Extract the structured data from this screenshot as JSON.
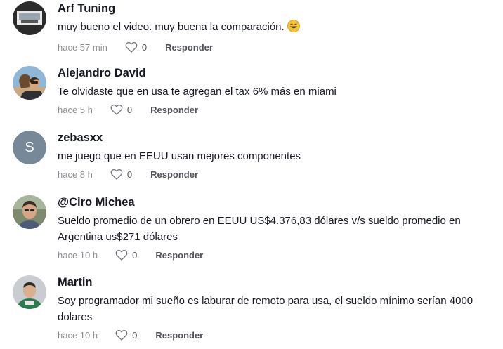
{
  "comments": [
    {
      "username": "Arf Tuning",
      "text": "muy bueno el video. muy buena la comparación.",
      "emoji": "grinning-sweat-emoji",
      "time": "hace 57 min",
      "likes": "0",
      "reply_label": "Responder"
    },
    {
      "username": "Alejandro David",
      "text": "Te olvidaste que en usa te agregan el tax 6% más en miami",
      "time": "hace 5 h",
      "likes": "0",
      "reply_label": "Responder"
    },
    {
      "username": "zebasxx",
      "avatar_letter": "S",
      "avatar_color": "#778899",
      "text": "me juego que en EEUU usan mejores componentes",
      "time": "hace 8 h",
      "likes": "0",
      "reply_label": "Responder"
    },
    {
      "username": "@Ciro Michea",
      "text": "Sueldo promedio de un obrero en EEUU US$4.376,83 dólares v/s sueldo promedio en Argentina us$271 dólares",
      "time": "hace 10 h",
      "likes": "0",
      "reply_label": "Responder"
    },
    {
      "username": "Martin",
      "text": "Soy programador mi sueño es laburar de remoto para usa, el sueldo mínimo serían 4000 dolares",
      "time": "hace 10 h",
      "likes": "0",
      "reply_label": "Responder"
    }
  ]
}
